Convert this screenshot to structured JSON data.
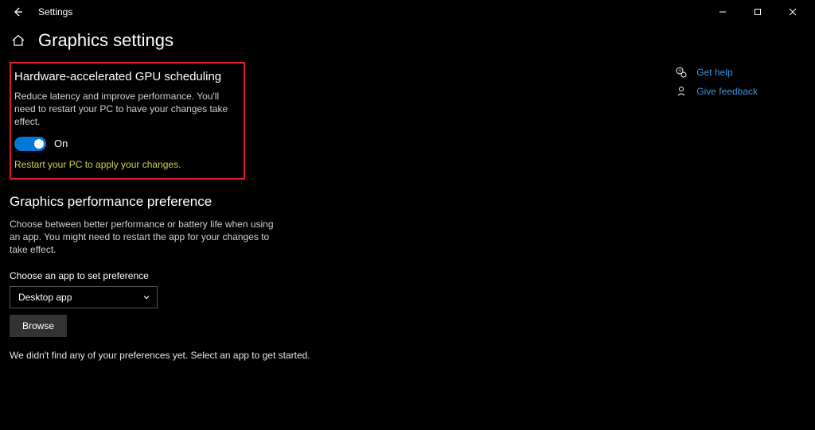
{
  "titlebar": {
    "title": "Settings"
  },
  "page": {
    "title": "Graphics settings"
  },
  "gpu": {
    "title": "Hardware-accelerated GPU scheduling",
    "desc": "Reduce latency and improve performance. You'll need to restart your PC to have your changes take effect.",
    "toggle_state": "On",
    "warning": "Restart your PC to apply your changes."
  },
  "perf": {
    "title": "Graphics performance preference",
    "desc": "Choose between better performance or battery life when using an app. You might need to restart the app for your changes to take effect.",
    "field_label": "Choose an app to set preference",
    "selected": "Desktop app",
    "browse_label": "Browse",
    "empty_msg": "We didn't find any of your preferences yet. Select an app to get started."
  },
  "sidebar": {
    "help": "Get help",
    "feedback": "Give feedback"
  }
}
